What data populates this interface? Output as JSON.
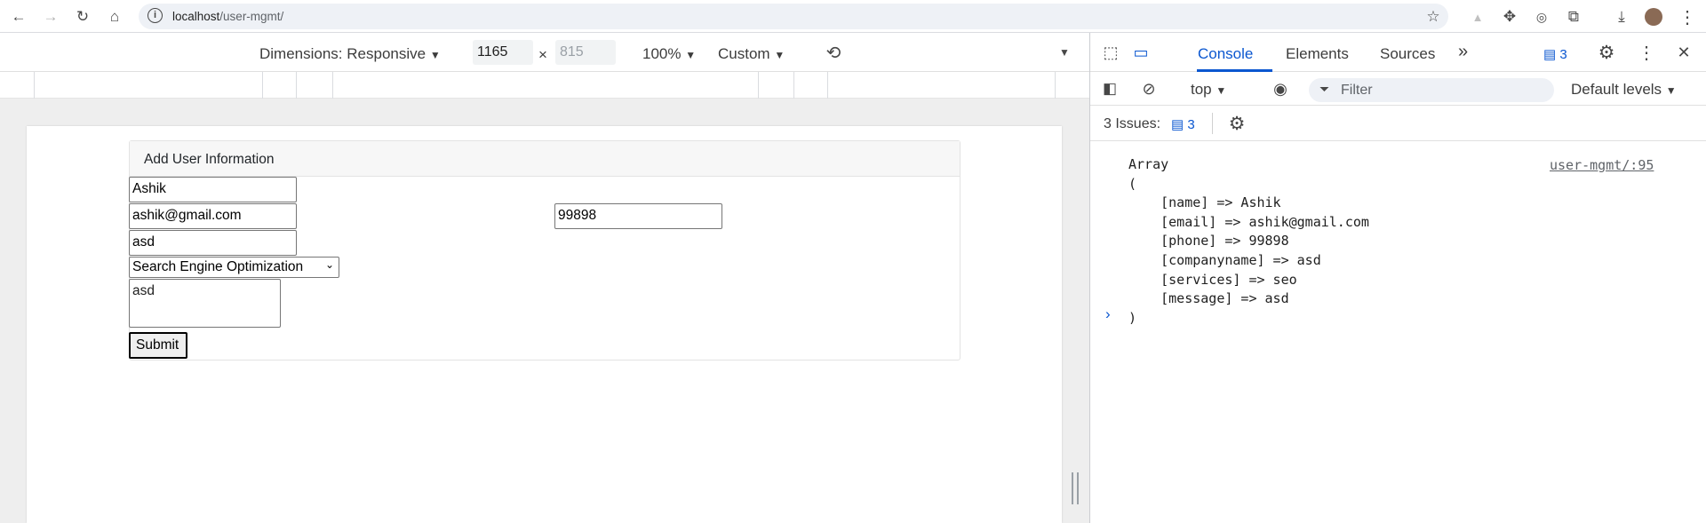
{
  "browser": {
    "url_host": "localhost",
    "url_path": "/user-mgmt/"
  },
  "device_toolbar": {
    "dimensions_label": "Dimensions: Responsive",
    "width": "1165",
    "times": "×",
    "height": "815",
    "zoom": "100%",
    "throttle": "Custom"
  },
  "form": {
    "title": "Add User Information",
    "name_value": "Ashik",
    "email_value": "ashik@gmail.com",
    "phone_value": "99898",
    "company_value": "asd",
    "service_selected": "Search Engine Optimization",
    "message_value": "asd",
    "submit_label": "Submit"
  },
  "devtools": {
    "tabs": [
      "Console",
      "Elements",
      "Sources"
    ],
    "issues_badge": "3",
    "context": "top",
    "filter_placeholder": "Filter",
    "levels": "Default levels",
    "issues_label": "3 Issues:",
    "issues_count": "3",
    "source_link": "user-mgmt/:95",
    "array_dump": "Array\n(\n    [name] => Ashik\n    [email] => ashik@gmail.com\n    [phone] => 99898\n    [companyname] => asd\n    [services] => seo\n    [message] => asd\n)",
    "prompt": "›"
  }
}
